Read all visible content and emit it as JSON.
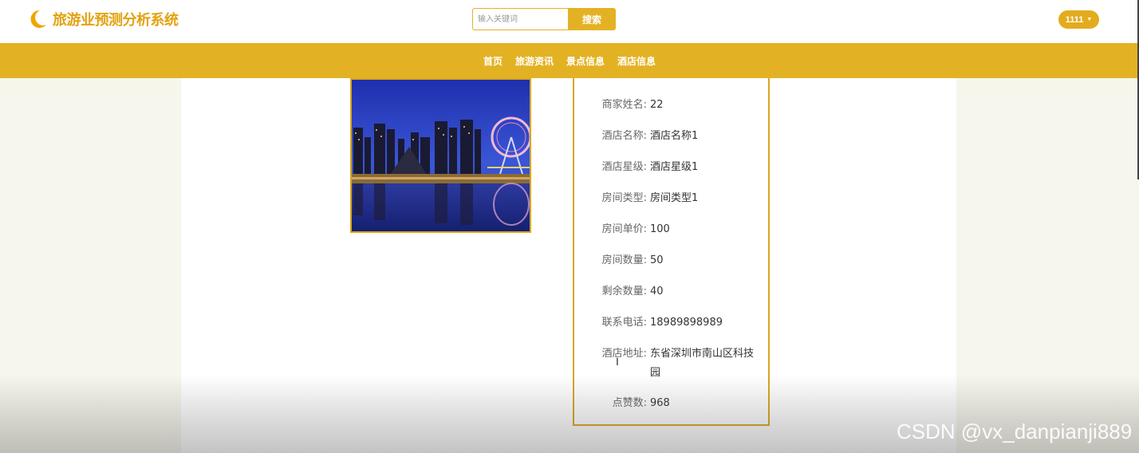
{
  "header": {
    "app_title": "旅游业预测分析系统",
    "search_placeholder": "输入关键词",
    "search_button": "搜索",
    "user_label": "1111"
  },
  "nav": {
    "items": [
      "首页",
      "旅游资讯",
      "景点信息",
      "酒店信息"
    ]
  },
  "detail": {
    "fields": [
      {
        "label": "商家姓名:",
        "value": "22"
      },
      {
        "label": "酒店名称:",
        "value": "酒店名称1"
      },
      {
        "label": "酒店星级:",
        "value": "酒店星级1"
      },
      {
        "label": "房间类型:",
        "value": "房间类型1"
      },
      {
        "label": "房间单价:",
        "value": "100"
      },
      {
        "label": "房间数量:",
        "value": "50"
      },
      {
        "label": "剩余数量:",
        "value": "40"
      },
      {
        "label": "联系电话:",
        "value": "18989898989"
      },
      {
        "label": "酒店地址:",
        "value": "东省深圳市南山区科技园"
      },
      {
        "label": "点赞数:",
        "value": "968"
      }
    ]
  },
  "watermark": "CSDN @vx_danpianji889",
  "colors": {
    "accent": "#e3b224",
    "brand_text": "#e3a20f",
    "page_bg": "#f7f6ec"
  }
}
